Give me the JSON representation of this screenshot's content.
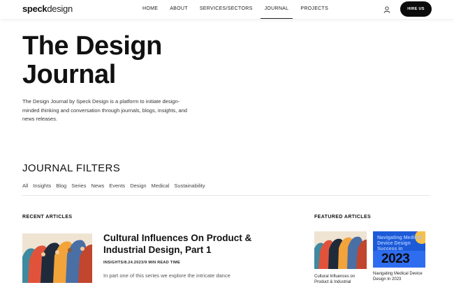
{
  "header": {
    "logo_bold": "speck",
    "logo_light": "design",
    "nav": [
      {
        "label": "HOME",
        "active": false
      },
      {
        "label": "ABOUT",
        "active": false
      },
      {
        "label": "SERVICES/SECTORS",
        "active": false
      },
      {
        "label": "JOURNAL",
        "active": true
      },
      {
        "label": "PROJECTS",
        "active": false
      }
    ],
    "hire_label": "HIRE US",
    "user_icon": "user-icon"
  },
  "hero": {
    "title_line1": "The Design",
    "title_line2": "Journal",
    "description": "The Design Journal by Speck Design is a platform to initiate design-minded thinking and conversation through journals, blogs, insights, and news releases."
  },
  "filters": {
    "title": "JOURNAL FILTERS",
    "tabs": [
      "All",
      "Insights",
      "Blog",
      "Series",
      "News",
      "Events",
      "Design",
      "Medical",
      "Sustainability"
    ]
  },
  "recent": {
    "label": "RECENT ARTICLES",
    "article": {
      "title": "Cultural Influences On Product & Industrial Design, Part 1",
      "meta": "INSIGHTS/8.24.2023/9 MIN READ TIME",
      "excerpt": "In part one of this series we explore the intricate dance"
    }
  },
  "featured": {
    "label": "FEATURED ARTICLES",
    "items": [
      {
        "caption": "Cultural Influences on Product & Industrial"
      },
      {
        "caption": "Navigating Medical Device Design In 2023",
        "image_text": "Navigating Medical Device Design Success in",
        "image_year": "2023"
      }
    ]
  },
  "colors": {
    "accent_dark": "#0b0b0b",
    "feature_blue": "#1d5ad8"
  }
}
